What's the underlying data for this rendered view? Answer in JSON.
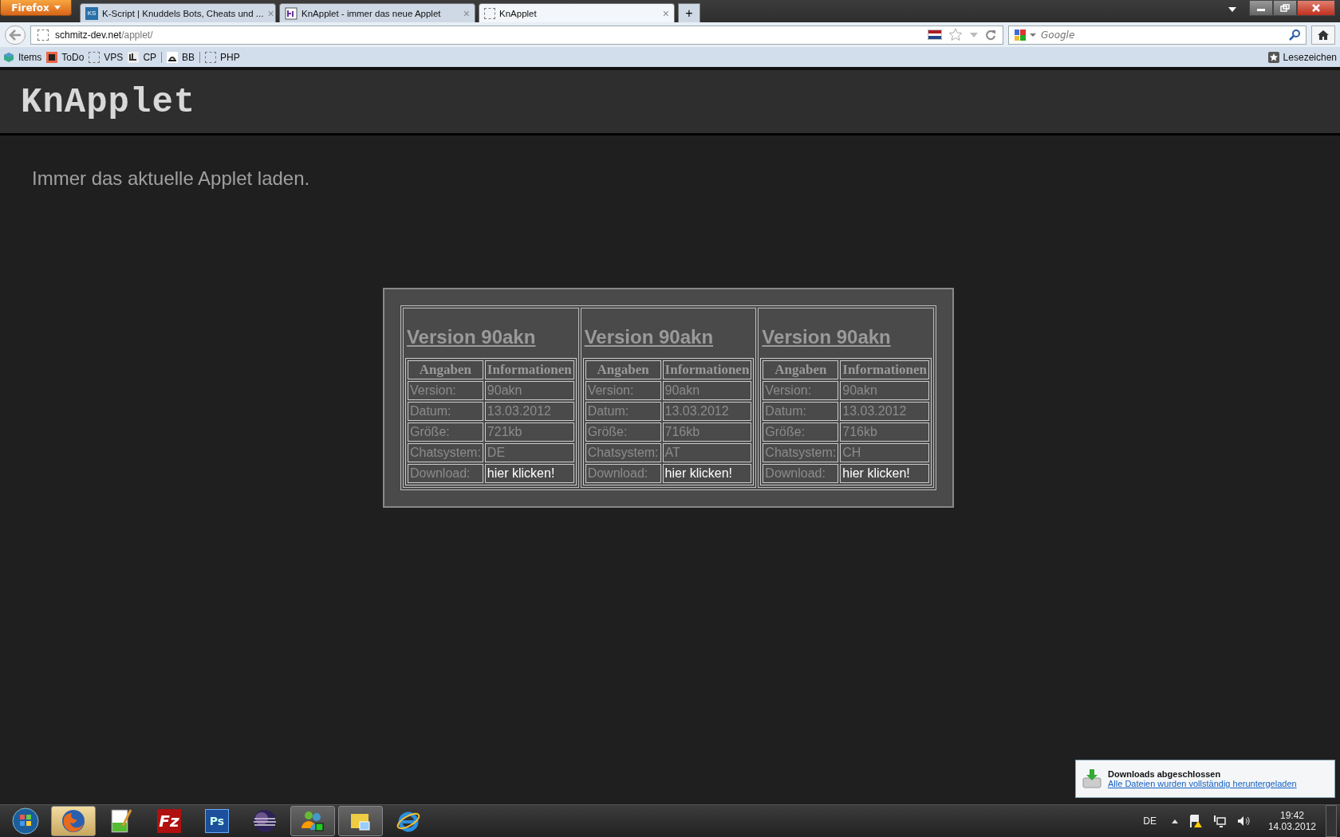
{
  "browser": {
    "menu_button": "Firefox",
    "tabs": [
      {
        "title": "K-Script | Knuddels Bots, Cheats und ...",
        "kind": "ks",
        "icon_text": "KS",
        "close": "×",
        "selected": false
      },
      {
        "title": "KnApplet - immer das neue Applet",
        "kind": "image",
        "close": "×",
        "selected": false
      },
      {
        "title": "KnApplet",
        "kind": "blank",
        "close": "×",
        "selected": true
      }
    ],
    "new_tab": "+",
    "address": {
      "domain": "schmitz-dev.net",
      "path": "/applet/"
    },
    "search": {
      "placeholder": "Google"
    },
    "bookmarks": [
      {
        "label": "Items",
        "kind": "cube",
        "divider_after": false
      },
      {
        "label": "ToDo",
        "kind": "pad",
        "divider_after": false
      },
      {
        "label": "VPS",
        "kind": "blank",
        "divider_after": false
      },
      {
        "label": "CP",
        "kind": "cp",
        "divider_after": true
      },
      {
        "label": "BB",
        "kind": "bb",
        "divider_after": true
      },
      {
        "label": "PHP",
        "kind": "blank",
        "divider_after": false
      }
    ],
    "bookmarks_menu": "Lesezeichen"
  },
  "page": {
    "logo": "KnApplet",
    "subtitle": "Immer das aktuelle Applet laden.",
    "versions": [
      {
        "title": "Version 90akn",
        "headers": [
          "Angaben",
          "Informationen"
        ],
        "rows": [
          {
            "label": "Version:",
            "value": "90akn"
          },
          {
            "label": "Datum:",
            "value": "13.03.2012"
          },
          {
            "label": "Größe:",
            "value": "721kb"
          },
          {
            "label": "Chatsystem:",
            "value": "DE"
          }
        ],
        "download_label": "Download:",
        "download_link": "hier klicken!"
      },
      {
        "title": "Version 90akn",
        "headers": [
          "Angaben",
          "Informationen"
        ],
        "rows": [
          {
            "label": "Version:",
            "value": "90akn"
          },
          {
            "label": "Datum:",
            "value": "13.03.2012"
          },
          {
            "label": "Größe:",
            "value": "716kb"
          },
          {
            "label": "Chatsystem:",
            "value": "AT"
          }
        ],
        "download_label": "Download:",
        "download_link": "hier klicken!"
      },
      {
        "title": "Version 90akn",
        "headers": [
          "Angaben",
          "Informationen"
        ],
        "rows": [
          {
            "label": "Version:",
            "value": "90akn"
          },
          {
            "label": "Datum:",
            "value": "13.03.2012"
          },
          {
            "label": "Größe:",
            "value": "716kb"
          },
          {
            "label": "Chatsystem:",
            "value": "CH"
          }
        ],
        "download_label": "Download:",
        "download_link": "hier klicken!"
      }
    ]
  },
  "notification": {
    "title": "Downloads abgeschlossen",
    "link": "Alle Dateien wurden vollständig heruntergeladen"
  },
  "taskbar": {
    "apps": [
      {
        "kind": "start",
        "selected": false,
        "running": false
      },
      {
        "kind": "firefox",
        "selected": true,
        "running": true
      },
      {
        "kind": "notepad",
        "selected": false,
        "running": false
      },
      {
        "kind": "filezilla",
        "glyph": "Fz",
        "selected": false,
        "running": false
      },
      {
        "kind": "photoshop",
        "glyph": "Ps",
        "selected": false,
        "running": false
      },
      {
        "kind": "eclipse",
        "selected": false,
        "running": false
      },
      {
        "kind": "messenger",
        "selected": false,
        "running": true
      },
      {
        "kind": "notes",
        "selected": false,
        "running": true
      },
      {
        "kind": "ie",
        "selected": false,
        "running": false
      }
    ],
    "language": "DE",
    "time": "19:42",
    "date": "14.03.2012"
  }
}
